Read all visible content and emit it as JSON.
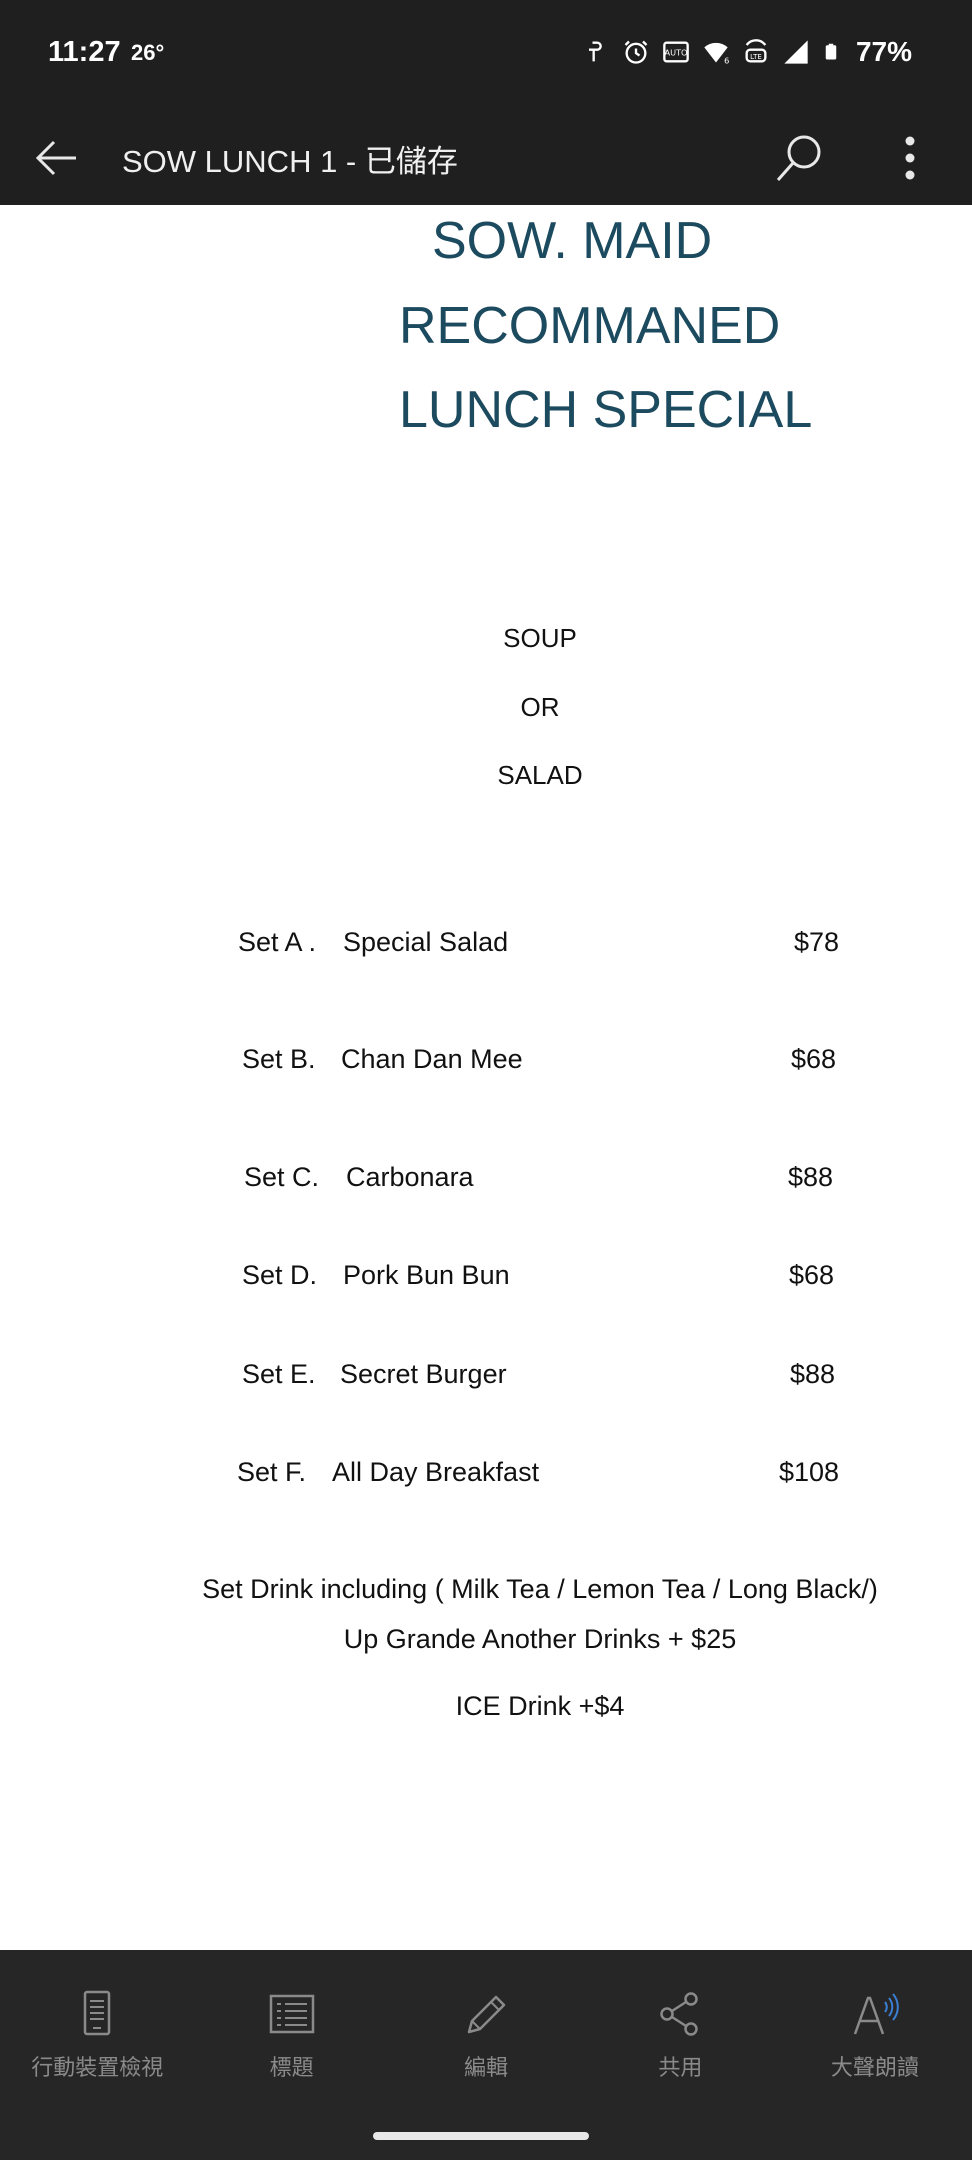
{
  "status_bar": {
    "time": "11:27",
    "temperature": "26°",
    "battery_percent": "77%",
    "icons": [
      "hotspot-icon",
      "alarm-icon",
      "auto-hd-icon",
      "wifi-6-icon",
      "volte-icon",
      "signal-icon",
      "battery-icon"
    ]
  },
  "app_bar": {
    "title": "SOW LUNCH 1 - 已儲存",
    "icons": [
      "back-arrow-icon",
      "search-icon",
      "more-vert-icon"
    ]
  },
  "document": {
    "heading": [
      "SOW. MAID",
      "RECOMMANED",
      "LUNCH SPECIAL"
    ],
    "choice_lines": [
      "SOUP",
      "OR",
      "SALAD"
    ],
    "menu": [
      {
        "set": "Set A .",
        "dish": "Special Salad",
        "price": "$78"
      },
      {
        "set": "Set B.",
        "dish": "Chan Dan Mee",
        "price": "$68"
      },
      {
        "set": "Set C.",
        "dish": "Carbonara",
        "price": "$88"
      },
      {
        "set": "Set D.",
        "dish": "Pork Bun Bun",
        "price": "$68"
      },
      {
        "set": "Set E.",
        "dish": "Secret Burger",
        "price": "$88"
      },
      {
        "set": "Set F.",
        "dish": "All Day Breakfast",
        "price": "$108"
      }
    ],
    "drink_lines": [
      "Set Drink including ( Milk Tea / Lemon Tea / Long Black/)",
      "Up Grande Another Drinks + $25",
      "ICE Drink +$4"
    ]
  },
  "toolbar": {
    "items": [
      {
        "label": "行動裝置檢視",
        "icon": "mobile-view-icon"
      },
      {
        "label": "標題",
        "icon": "headings-icon"
      },
      {
        "label": "編輯",
        "icon": "pencil-icon"
      },
      {
        "label": "共用",
        "icon": "share-icon"
      },
      {
        "label": "大聲朗讀",
        "icon": "read-aloud-icon"
      }
    ]
  },
  "colors": {
    "bar_background": "#1f1f1f",
    "toolbar_background": "#262626",
    "heading_color": "#1c4a5e",
    "toolbar_text": "#8a8a8a"
  }
}
